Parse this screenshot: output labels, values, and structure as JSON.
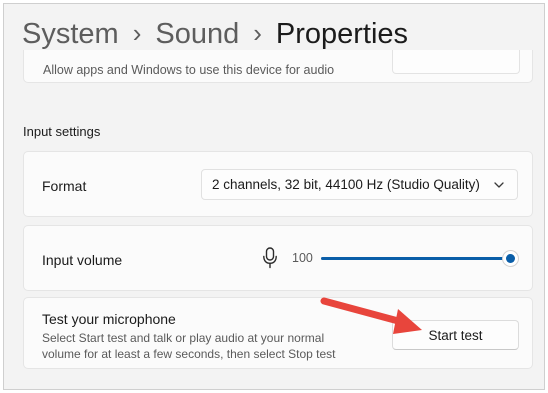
{
  "breadcrumb": {
    "items": [
      "System",
      "Sound"
    ],
    "current": "Properties",
    "separator": "›"
  },
  "top_card": {
    "text": "Allow apps and Windows to use this device for audio"
  },
  "input_settings": {
    "title": "Input settings",
    "format": {
      "label": "Format",
      "selected": "2 channels, 32 bit, 44100 Hz (Studio Quality)",
      "chevron_icon": "chevron-down-icon"
    },
    "volume": {
      "label": "Input volume",
      "value": "100",
      "level": 1.0,
      "icon": "microphone-icon"
    },
    "test": {
      "title": "Test your microphone",
      "description": "Select Start test and talk or play audio at your normal volume for at least a few seconds, then select Stop test",
      "button_label": "Start test"
    }
  },
  "annotation": {
    "arrow_color": "#e8453c"
  },
  "colors": {
    "accent": "#0a5ea8",
    "background": "#f3f3f3",
    "card": "#fbfbfb"
  }
}
